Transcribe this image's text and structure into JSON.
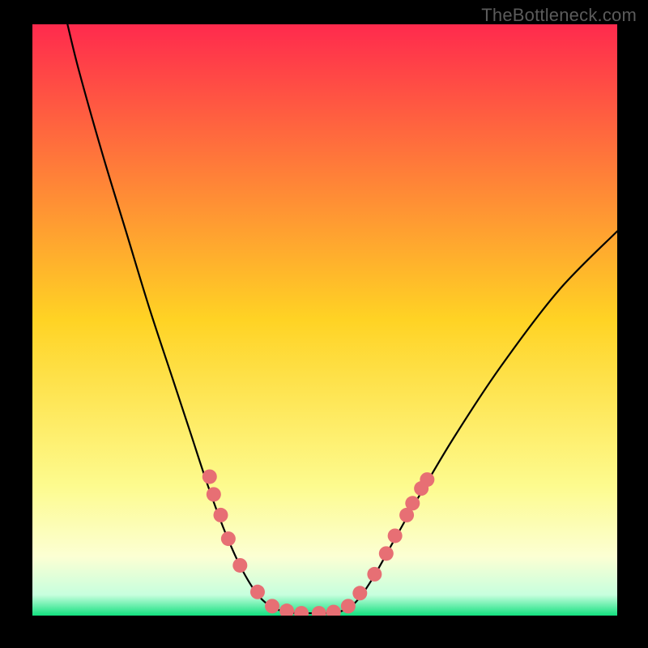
{
  "watermark": "TheBottleneck.com",
  "chart_data": {
    "type": "line",
    "title": "",
    "xlabel": "",
    "ylabel": "",
    "xlim": [
      0,
      100
    ],
    "ylim": [
      0,
      100
    ],
    "background_gradient": {
      "stops": [
        {
          "offset": 0.0,
          "color": "#ff2a4d"
        },
        {
          "offset": 0.5,
          "color": "#ffd324"
        },
        {
          "offset": 0.78,
          "color": "#fdfb8e"
        },
        {
          "offset": 0.9,
          "color": "#fcffd3"
        },
        {
          "offset": 0.965,
          "color": "#c7ffde"
        },
        {
          "offset": 1.0,
          "color": "#12e07f"
        }
      ]
    },
    "series": [
      {
        "name": "left-curve",
        "type": "line",
        "color": "#000000",
        "points": [
          {
            "x": 6.0,
            "y": 100.0
          },
          {
            "x": 8.0,
            "y": 92.0
          },
          {
            "x": 12.0,
            "y": 78.0
          },
          {
            "x": 16.0,
            "y": 65.0
          },
          {
            "x": 20.0,
            "y": 52.0
          },
          {
            "x": 24.0,
            "y": 40.0
          },
          {
            "x": 27.0,
            "y": 31.0
          },
          {
            "x": 30.0,
            "y": 22.0
          },
          {
            "x": 33.0,
            "y": 14.0
          },
          {
            "x": 36.0,
            "y": 7.5
          },
          {
            "x": 39.0,
            "y": 3.0
          },
          {
            "x": 42.0,
            "y": 1.0
          },
          {
            "x": 45.0,
            "y": 0.4
          }
        ]
      },
      {
        "name": "valley-floor",
        "type": "line",
        "color": "#000000",
        "points": [
          {
            "x": 45.0,
            "y": 0.4
          },
          {
            "x": 52.0,
            "y": 0.4
          }
        ]
      },
      {
        "name": "right-curve",
        "type": "line",
        "color": "#000000",
        "points": [
          {
            "x": 52.0,
            "y": 0.4
          },
          {
            "x": 55.0,
            "y": 2.0
          },
          {
            "x": 58.0,
            "y": 6.0
          },
          {
            "x": 62.0,
            "y": 13.0
          },
          {
            "x": 66.0,
            "y": 20.0
          },
          {
            "x": 72.0,
            "y": 30.0
          },
          {
            "x": 80.0,
            "y": 42.0
          },
          {
            "x": 90.0,
            "y": 55.0
          },
          {
            "x": 100.0,
            "y": 65.0
          }
        ]
      }
    ],
    "markers": {
      "color": "#e76f74",
      "radius": 9,
      "points": [
        {
          "x": 30.3,
          "y": 23.5
        },
        {
          "x": 31.0,
          "y": 20.5
        },
        {
          "x": 32.2,
          "y": 17.0
        },
        {
          "x": 33.5,
          "y": 13.0
        },
        {
          "x": 35.5,
          "y": 8.5
        },
        {
          "x": 38.5,
          "y": 4.0
        },
        {
          "x": 41.0,
          "y": 1.6
        },
        {
          "x": 43.5,
          "y": 0.8
        },
        {
          "x": 46.0,
          "y": 0.4
        },
        {
          "x": 49.0,
          "y": 0.4
        },
        {
          "x": 51.5,
          "y": 0.6
        },
        {
          "x": 54.0,
          "y": 1.6
        },
        {
          "x": 56.0,
          "y": 3.8
        },
        {
          "x": 58.5,
          "y": 7.0
        },
        {
          "x": 60.5,
          "y": 10.5
        },
        {
          "x": 62.0,
          "y": 13.5
        },
        {
          "x": 64.0,
          "y": 17.0
        },
        {
          "x": 65.0,
          "y": 19.0
        },
        {
          "x": 66.5,
          "y": 21.5
        },
        {
          "x": 67.5,
          "y": 23.0
        }
      ]
    }
  }
}
